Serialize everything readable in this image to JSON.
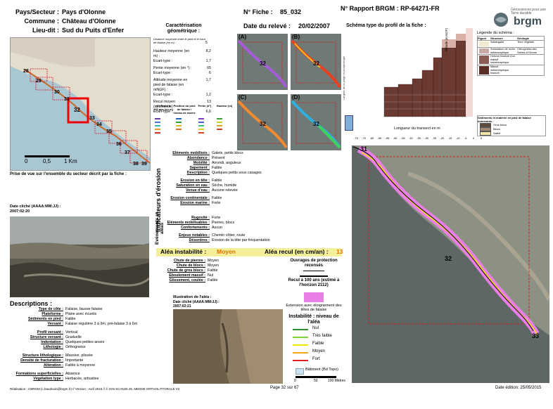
{
  "header": {
    "pays_label": "Pays/Secteur :",
    "pays_value": "Pays d'Olonne",
    "commune_label": "Commune :",
    "commune_value": "Château d'Olonne",
    "lieudit_label": "Lieu-dit :",
    "lieudit_value": "Sud du Puits d'Enfer",
    "fiche_label": "N° Fiche :",
    "fiche_value": "85_032",
    "releve_label": "Date du relevé :",
    "releve_value": "20/02/2007",
    "rapport_label": "N° Rapport BRGM : RP-64271-FR",
    "schema_title": "Schéma type du profil de la fiche :",
    "brgm_logo": "brgm",
    "brgm_tagline": "Géosciences pour une Terre durable"
  },
  "location_map": {
    "labels": [
      "28",
      "29",
      "30",
      "31",
      "32",
      "33",
      "34",
      "35",
      "36",
      "37",
      "38",
      "39"
    ],
    "scale": [
      "0",
      "0,5",
      "1 Km"
    ]
  },
  "photo1": {
    "title": "Prise de vue sur l'ensemble du secteur décrit par la fiche :",
    "date_label": "Date cliché (AAAA:MM:JJ) :",
    "date_value": "2007:02:20"
  },
  "descriptions": {
    "title": "Descriptions :",
    "rows": [
      {
        "k": "Type de côte :",
        "v": "Falaise, fausse falaise"
      },
      {
        "k": "Plateforme :",
        "v": "Plane avec écueils"
      },
      {
        "k": "Sédiments en pied :",
        "v": "Faible"
      },
      {
        "k": "Versant :",
        "v": "Falaise régulière 3 à 9m, pré-falaise 3 à 6m"
      },
      {
        "k": "Profil versant :",
        "v": "Vertical"
      },
      {
        "k": "Structure versant :",
        "v": "Graduelle"
      },
      {
        "k": "Indentation :",
        "v": "Quelques petites anses"
      },
      {
        "k": "Lithologie :",
        "v": "Orthogneiss"
      },
      {
        "k": "Structure lithologique :",
        "v": "Massive, plissée"
      },
      {
        "k": "Densité de fracturation :",
        "v": "Importante"
      },
      {
        "k": "Altération :",
        "v": "Faible à moyenne"
      },
      {
        "k": "Formations superficielles :",
        "v": "Absence"
      },
      {
        "k": "Végétation type :",
        "v": "Herbacée, arbustive"
      }
    ]
  },
  "geometry": {
    "title": "Caractérisation géométrique :",
    "note": "Distance moyenne entre le pied et le haut de falaise (en m) :",
    "note_value": "5",
    "rows": [
      {
        "k": "Hauteur moyenne (en m) :",
        "v": "8,2"
      },
      {
        "k": "Ecart-type :",
        "v": "1,7"
      },
      {
        "k": "Pente moyenne (en °) :",
        "v": "65"
      },
      {
        "k": "Ecart-type :",
        "v": "6"
      },
      {
        "k": "Altitude moyenne en pied de falaise (en mNGF) :",
        "v": "1,7"
      },
      {
        "k": "Ecart-type :",
        "v": "1,2"
      },
      {
        "k": "Recul moyen (mm/siècle) :",
        "v": "13"
      },
      {
        "k": "Ecart-type :",
        "v": "6,6"
      }
    ],
    "legend_headers": [
      "(C) Recul à 100 ans (en m)",
      "Position du pied de falaise / niveau de marée",
      "Pente (d°)",
      "Hauteur (m)"
    ]
  },
  "mini_maps": [
    {
      "letter": "(A)",
      "label": "32"
    },
    {
      "letter": "(B)",
      "label": "32"
    },
    {
      "letter": "(C)",
      "label": "32"
    },
    {
      "letter": "(D)",
      "label": "32"
    }
  ],
  "erosion": {
    "side_label": "Indicateurs d'érosion",
    "rows": [
      {
        "k": "Eléments mobilisés :",
        "v": "Galets, petits blocs"
      },
      {
        "k": "Abondance :",
        "v": "Présent"
      },
      {
        "k": "Mobilité :",
        "v": "Arrondi, anguleux"
      },
      {
        "k": "Sapement :",
        "v": "Faible"
      },
      {
        "k": "Description :",
        "v": "Quelques petits sous cavages"
      },
      {
        "k": "Erosion en tête :",
        "v": "Faible"
      },
      {
        "k": "Saturation en eau :",
        "v": "Sèche, humide"
      },
      {
        "k": "Venue d'eau :",
        "v": "Aucune relevée"
      },
      {
        "k": "Erosion continentale :",
        "v": "Faible"
      },
      {
        "k": "Erosion marine :",
        "v": "Forte"
      }
    ]
  },
  "events": {
    "side_label": "Evénements et aléas",
    "rows": [
      {
        "k": "Rugosité :",
        "v": "Forte"
      },
      {
        "k": "Eléments mobilisables :",
        "v": "Pierres, blocs"
      },
      {
        "k": "Confortements :",
        "v": "Aucun"
      },
      {
        "k": "Enjeux notables :",
        "v": "Chemin côtier, route"
      },
      {
        "k": "Désordres :",
        "v": "Erosion de la tête par fréquentation"
      }
    ]
  },
  "alea": {
    "instab_label": "Aléa instabilité :",
    "instab_value": "Moyen",
    "recul_label": "Aléa recul (en cm/an) :",
    "recul_value": "13",
    "rows": [
      {
        "k": "Chute de pierres :",
        "v": "Moyen"
      },
      {
        "k": "Chute de blocs :",
        "v": "Moyen"
      },
      {
        "k": "Chute de gros blocs :",
        "v": "Faible"
      },
      {
        "k": "Eboulement massif :",
        "v": "Nul"
      },
      {
        "k": "Glissement, coulée :",
        "v": "Faible"
      }
    ]
  },
  "photo2": {
    "title": "Illustration de l'aléa :",
    "date_label": "Date cliché (AAAA:MM:JJ) :",
    "date_value": "2007:02:21"
  },
  "legend": {
    "ouvrages": "Ouvrages de protection recensés",
    "recul": "Recul à 100 ans (estimé à l'horizon 2112)",
    "extension": "Extension avec éloignement des têtes de falaise",
    "instab_title": "Instabilité : niveau de l'aléa",
    "levels": [
      {
        "name": "Nul",
        "color": "#2e8b2e"
      },
      {
        "name": "Très faible",
        "color": "#7fd43a"
      },
      {
        "name": "Faible",
        "color": "#f2e600"
      },
      {
        "name": "Moyen",
        "color": "#f5a623"
      },
      {
        "name": "Fort",
        "color": "#e02020"
      }
    ],
    "batiment": "Bâtiment (Bd Topo)",
    "scale": [
      "0",
      "50",
      "100 Mètres"
    ]
  },
  "profile": {
    "y_label": "Altitude (m NGF)",
    "x_label": "Longueur du transect en m",
    "x_ticks": [
      "-75",
      "-70",
      "-65",
      "-60",
      "-55",
      "-50",
      "-45",
      "-40",
      "-35",
      "-30",
      "-25",
      "-20",
      "-15",
      "-10",
      "-5",
      "0",
      "5"
    ],
    "legend_title": "Légende du schéma :",
    "legend_headers": [
      "Figuré",
      "Structure",
      "Géologie"
    ],
    "legend_rows": [
      {
        "s": "Sable/galet",
        "g": "Terre végétale"
      },
      {
        "s": "Substratum de roche métamorphique",
        "g": "Orthogneiss des Sables-d'Olonne"
      },
      {
        "s": "Horizon fracturé d'un massif métamorphique",
        "g": ""
      },
      {
        "s": "Massif métamorphique fracturé",
        "g": ""
      }
    ],
    "sediment_title": "Sédiments et matériel en pied de falaise dominants :",
    "sediment_rows": [
      "Gros blocs",
      "Blocs",
      "Sable"
    ],
    "left_caption": "Largeur de la plage et morphologie"
  },
  "aerial": {
    "labels": [
      "31",
      "32",
      "33"
    ]
  },
  "footer": {
    "realisation": "Réalisation : CBRGM (c.baudouin@brgm.fr) // Version : Avril 2015 // © IGN SCAN25 25, MEDDE ORTHOLITTORALE V2",
    "page": "Page 32 sur 67",
    "edition": "Date édition: 25/05/2015"
  }
}
